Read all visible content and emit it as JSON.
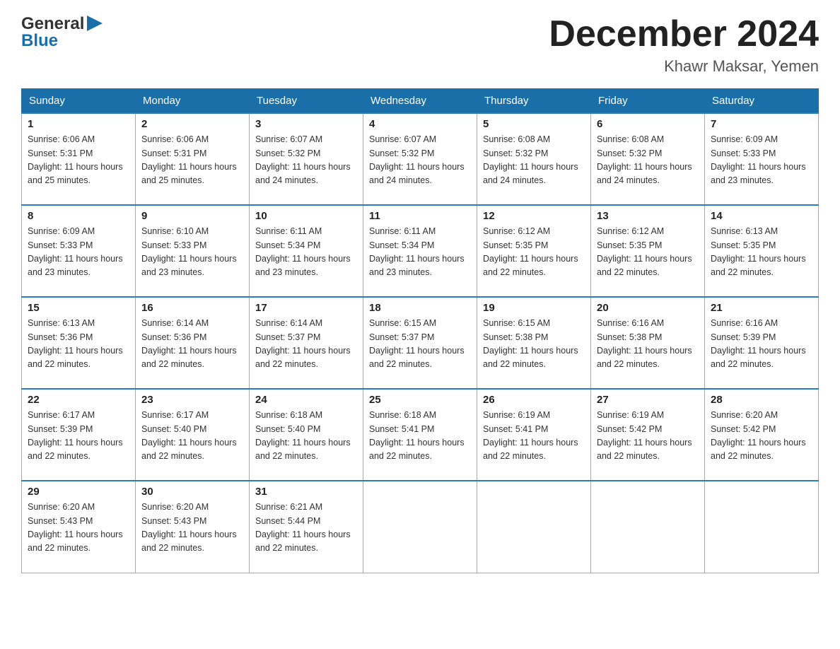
{
  "header": {
    "logo_line1": "General",
    "logo_line2": "Blue",
    "month_title": "December 2024",
    "subtitle": "Khawr Maksar, Yemen"
  },
  "weekdays": [
    "Sunday",
    "Monday",
    "Tuesday",
    "Wednesday",
    "Thursday",
    "Friday",
    "Saturday"
  ],
  "weeks": [
    [
      {
        "day": "1",
        "sunrise": "6:06 AM",
        "sunset": "5:31 PM",
        "daylight": "11 hours and 25 minutes."
      },
      {
        "day": "2",
        "sunrise": "6:06 AM",
        "sunset": "5:31 PM",
        "daylight": "11 hours and 25 minutes."
      },
      {
        "day": "3",
        "sunrise": "6:07 AM",
        "sunset": "5:32 PM",
        "daylight": "11 hours and 24 minutes."
      },
      {
        "day": "4",
        "sunrise": "6:07 AM",
        "sunset": "5:32 PM",
        "daylight": "11 hours and 24 minutes."
      },
      {
        "day": "5",
        "sunrise": "6:08 AM",
        "sunset": "5:32 PM",
        "daylight": "11 hours and 24 minutes."
      },
      {
        "day": "6",
        "sunrise": "6:08 AM",
        "sunset": "5:32 PM",
        "daylight": "11 hours and 24 minutes."
      },
      {
        "day": "7",
        "sunrise": "6:09 AM",
        "sunset": "5:33 PM",
        "daylight": "11 hours and 23 minutes."
      }
    ],
    [
      {
        "day": "8",
        "sunrise": "6:09 AM",
        "sunset": "5:33 PM",
        "daylight": "11 hours and 23 minutes."
      },
      {
        "day": "9",
        "sunrise": "6:10 AM",
        "sunset": "5:33 PM",
        "daylight": "11 hours and 23 minutes."
      },
      {
        "day": "10",
        "sunrise": "6:11 AM",
        "sunset": "5:34 PM",
        "daylight": "11 hours and 23 minutes."
      },
      {
        "day": "11",
        "sunrise": "6:11 AM",
        "sunset": "5:34 PM",
        "daylight": "11 hours and 23 minutes."
      },
      {
        "day": "12",
        "sunrise": "6:12 AM",
        "sunset": "5:35 PM",
        "daylight": "11 hours and 22 minutes."
      },
      {
        "day": "13",
        "sunrise": "6:12 AM",
        "sunset": "5:35 PM",
        "daylight": "11 hours and 22 minutes."
      },
      {
        "day": "14",
        "sunrise": "6:13 AM",
        "sunset": "5:35 PM",
        "daylight": "11 hours and 22 minutes."
      }
    ],
    [
      {
        "day": "15",
        "sunrise": "6:13 AM",
        "sunset": "5:36 PM",
        "daylight": "11 hours and 22 minutes."
      },
      {
        "day": "16",
        "sunrise": "6:14 AM",
        "sunset": "5:36 PM",
        "daylight": "11 hours and 22 minutes."
      },
      {
        "day": "17",
        "sunrise": "6:14 AM",
        "sunset": "5:37 PM",
        "daylight": "11 hours and 22 minutes."
      },
      {
        "day": "18",
        "sunrise": "6:15 AM",
        "sunset": "5:37 PM",
        "daylight": "11 hours and 22 minutes."
      },
      {
        "day": "19",
        "sunrise": "6:15 AM",
        "sunset": "5:38 PM",
        "daylight": "11 hours and 22 minutes."
      },
      {
        "day": "20",
        "sunrise": "6:16 AM",
        "sunset": "5:38 PM",
        "daylight": "11 hours and 22 minutes."
      },
      {
        "day": "21",
        "sunrise": "6:16 AM",
        "sunset": "5:39 PM",
        "daylight": "11 hours and 22 minutes."
      }
    ],
    [
      {
        "day": "22",
        "sunrise": "6:17 AM",
        "sunset": "5:39 PM",
        "daylight": "11 hours and 22 minutes."
      },
      {
        "day": "23",
        "sunrise": "6:17 AM",
        "sunset": "5:40 PM",
        "daylight": "11 hours and 22 minutes."
      },
      {
        "day": "24",
        "sunrise": "6:18 AM",
        "sunset": "5:40 PM",
        "daylight": "11 hours and 22 minutes."
      },
      {
        "day": "25",
        "sunrise": "6:18 AM",
        "sunset": "5:41 PM",
        "daylight": "11 hours and 22 minutes."
      },
      {
        "day": "26",
        "sunrise": "6:19 AM",
        "sunset": "5:41 PM",
        "daylight": "11 hours and 22 minutes."
      },
      {
        "day": "27",
        "sunrise": "6:19 AM",
        "sunset": "5:42 PM",
        "daylight": "11 hours and 22 minutes."
      },
      {
        "day": "28",
        "sunrise": "6:20 AM",
        "sunset": "5:42 PM",
        "daylight": "11 hours and 22 minutes."
      }
    ],
    [
      {
        "day": "29",
        "sunrise": "6:20 AM",
        "sunset": "5:43 PM",
        "daylight": "11 hours and 22 minutes."
      },
      {
        "day": "30",
        "sunrise": "6:20 AM",
        "sunset": "5:43 PM",
        "daylight": "11 hours and 22 minutes."
      },
      {
        "day": "31",
        "sunrise": "6:21 AM",
        "sunset": "5:44 PM",
        "daylight": "11 hours and 22 minutes."
      },
      null,
      null,
      null,
      null
    ]
  ],
  "labels": {
    "sunrise_prefix": "Sunrise: ",
    "sunset_prefix": "Sunset: ",
    "daylight_prefix": "Daylight: "
  }
}
